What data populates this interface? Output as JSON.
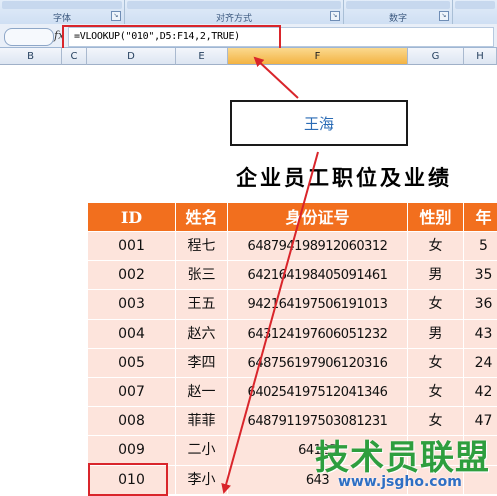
{
  "ribbon": {
    "groups": [
      {
        "label": "字体"
      },
      {
        "label": "对齐方式"
      },
      {
        "label": "数字"
      }
    ]
  },
  "formula_bar": {
    "fx_label": "fx",
    "formula": "=VLOOKUP(\"010\",D5:F14,2,TRUE)"
  },
  "columns": [
    "B",
    "C",
    "D",
    "E",
    "F",
    "G",
    "H"
  ],
  "selected_column": "F",
  "callout": {
    "value": "王海"
  },
  "sheet_title": "企业员工职位及业绩",
  "table": {
    "headers": [
      "ID",
      "姓名",
      "身份证号",
      "性别",
      "年"
    ],
    "rows": [
      [
        "001",
        "程七",
        "648794198912060312",
        "女",
        "5"
      ],
      [
        "002",
        "张三",
        "642164198405091461",
        "男",
        "35"
      ],
      [
        "003",
        "王五",
        "942164197506191013",
        "女",
        "36"
      ],
      [
        "004",
        "赵六",
        "643124197606051232",
        "男",
        "43"
      ],
      [
        "005",
        "李四",
        "648756197906120316",
        "女",
        "24"
      ],
      [
        "007",
        "赵一",
        "640254197512041346",
        "女",
        "42"
      ],
      [
        "008",
        "菲菲",
        "648791197503081231",
        "女",
        "47"
      ],
      [
        "009",
        "二小",
        "64125",
        "",
        ""
      ],
      [
        "010",
        "李小",
        "643",
        "",
        ""
      ]
    ]
  },
  "watermark": {
    "title": "技术员联盟",
    "url": "www.jsgho.com"
  },
  "colors": {
    "header_orange": "#f26f1e",
    "row_pink": "#fde4dc",
    "highlight_red": "#d9252b",
    "callout_text": "#2a6bb5"
  }
}
